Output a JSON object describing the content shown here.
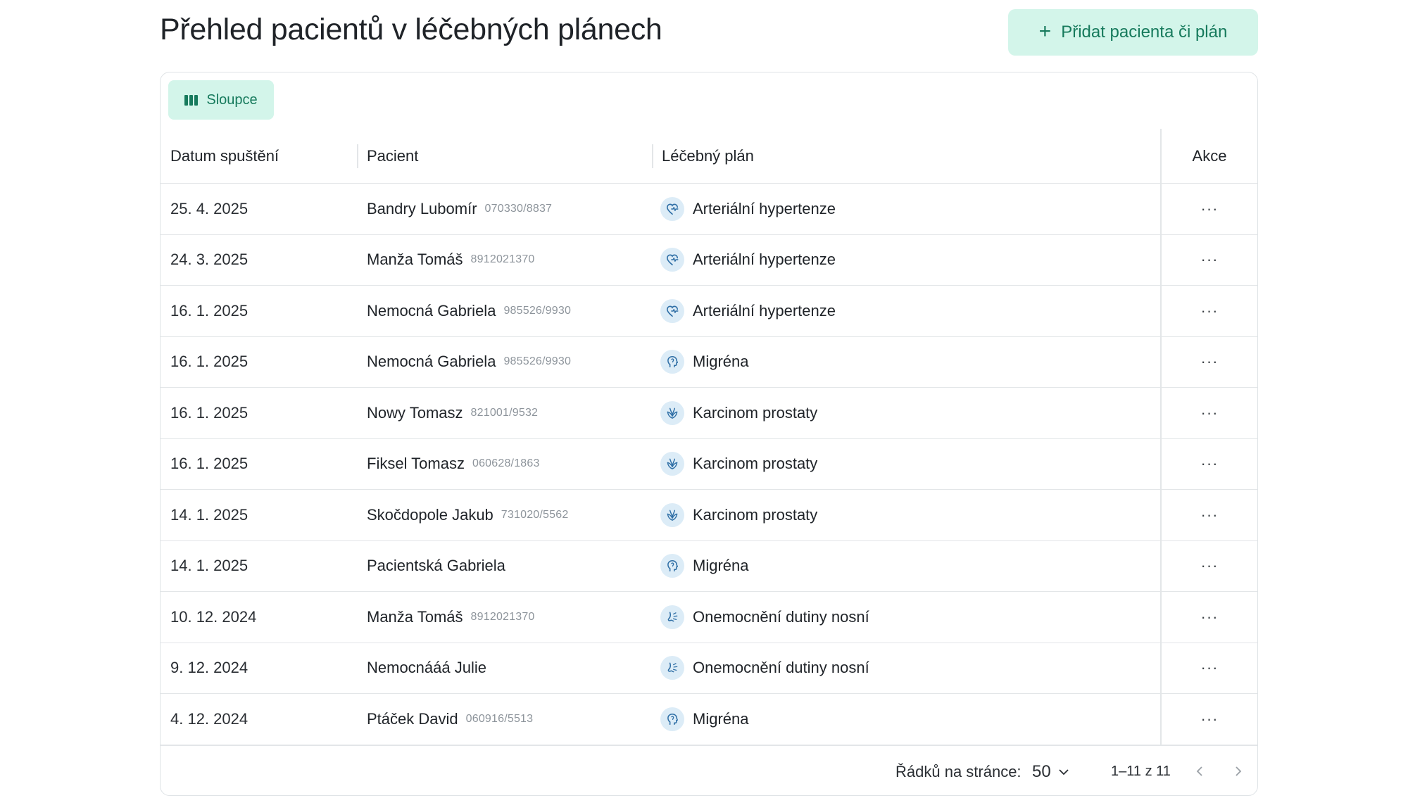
{
  "header": {
    "title": "Přehled pacientů v léčebných plánech",
    "add_button_label": "Přidat pacienta či plán"
  },
  "toolbar": {
    "columns_button_label": "Sloupce"
  },
  "table": {
    "columns": [
      "Datum spuštění",
      "Pacient",
      "Léčebný plán",
      "Akce"
    ],
    "rows": [
      {
        "date": "25. 4. 2025",
        "patient_name": "Bandry Lubomír",
        "patient_id": "070330/8837",
        "plan": "Arteriální hypertenze",
        "plan_icon": "heart-pulse-icon",
        "actions": "···"
      },
      {
        "date": "24. 3. 2025",
        "patient_name": "Manža Tomáš",
        "patient_id": "8912021370",
        "plan": "Arteriální hypertenze",
        "plan_icon": "heart-pulse-icon",
        "actions": "···"
      },
      {
        "date": "16. 1. 2025",
        "patient_name": "Nemocná Gabriela",
        "patient_id": "985526/9930",
        "plan": "Arteriální hypertenze",
        "plan_icon": "heart-pulse-icon",
        "actions": "···"
      },
      {
        "date": "16. 1. 2025",
        "patient_name": "Nemocná Gabriela",
        "patient_id": "985526/9930",
        "plan": "Migréna",
        "plan_icon": "head-icon",
        "actions": "···"
      },
      {
        "date": "16. 1. 2025",
        "patient_name": "Nowy Tomasz",
        "patient_id": "821001/9532",
        "plan": "Karcinom prostaty",
        "plan_icon": "ribbon-icon",
        "actions": "···"
      },
      {
        "date": "16. 1. 2025",
        "patient_name": "Fiksel Tomasz",
        "patient_id": "060628/1863",
        "plan": "Karcinom prostaty",
        "plan_icon": "ribbon-icon",
        "actions": "···"
      },
      {
        "date": "14. 1. 2025",
        "patient_name": "Skočdopole Jakub",
        "patient_id": "731020/5562",
        "plan": "Karcinom prostaty",
        "plan_icon": "ribbon-icon",
        "actions": "···"
      },
      {
        "date": "14. 1. 2025",
        "patient_name": "Pacientská Gabriela",
        "patient_id": "",
        "plan": "Migréna",
        "plan_icon": "head-icon",
        "actions": "···"
      },
      {
        "date": "10. 12. 2024",
        "patient_name": "Manža Tomáš",
        "patient_id": "8912021370",
        "plan": "Onemocnění dutiny nosní",
        "plan_icon": "nose-icon",
        "actions": "···"
      },
      {
        "date": "9. 12. 2024",
        "patient_name": "Nemocnááá Julie",
        "patient_id": "",
        "plan": "Onemocnění dutiny nosní",
        "plan_icon": "nose-icon",
        "actions": "···"
      },
      {
        "date": "4. 12. 2024",
        "patient_name": "Ptáček David",
        "patient_id": "060916/5513",
        "plan": "Migréna",
        "plan_icon": "head-icon",
        "actions": "···"
      }
    ]
  },
  "pagination": {
    "rows_per_page_label": "Řádků na stránce:",
    "rows_per_page_value": "50",
    "range_label": "1–11 z 11"
  },
  "colors": {
    "accent": "#167a5c",
    "accent_bg": "#d3f5ea",
    "plan_icon_bg": "#dcecf7",
    "plan_icon_fg": "#2f6fa6"
  }
}
